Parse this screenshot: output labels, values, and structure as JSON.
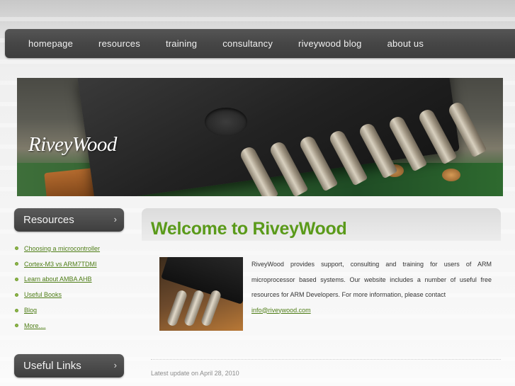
{
  "nav": {
    "items": [
      "homepage",
      "resources",
      "training",
      "consultancy",
      "riveywood blog",
      "about us"
    ]
  },
  "banner": {
    "logo_text": "RiveyWood"
  },
  "sidebar": {
    "resources_title": "Resources",
    "resources_links": [
      "Choosing a microcontroller",
      "Cortex-M3 vs ARM7TDMI",
      "Learn about AMBA AHB",
      "Useful Books",
      "Blog",
      "More...."
    ],
    "useful_links_title": "Useful Links",
    "chevron": "›"
  },
  "main": {
    "title": "Welcome to RiveyWood",
    "body": "RiveyWood provides support, consulting and training for users of ARM microprocessor based systems. Our website includes a number of useful free resources for ARM Developers. For more information, please contact",
    "email": "info@riveywood.com",
    "update": "Latest update on April 28, 2010"
  },
  "colors": {
    "accent_green": "#5a9a1a",
    "link_green": "#4e7d16",
    "nav_bg": "#464646"
  }
}
